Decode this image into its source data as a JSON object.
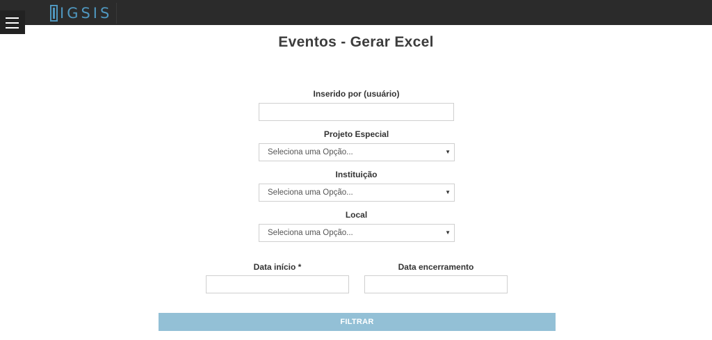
{
  "header": {
    "logo_text": "IGSIS",
    "menu_icon": "hamburger-icon",
    "colors": {
      "bar": "#2b2b2b",
      "logo": "#4f97bf"
    }
  },
  "page": {
    "title": "Eventos - Gerar Excel"
  },
  "form": {
    "inserido_por": {
      "label": "Inserido por (usuário)",
      "value": ""
    },
    "projeto_especial": {
      "label": "Projeto Especial",
      "selected": "Seleciona uma Opção..."
    },
    "instituicao": {
      "label": "Instituição",
      "selected": "Seleciona uma Opção..."
    },
    "local": {
      "label": "Local",
      "selected": "Seleciona uma Opção..."
    },
    "data_inicio": {
      "label": "Data início *",
      "value": ""
    },
    "data_encerramento": {
      "label": "Data encerramento",
      "value": ""
    },
    "submit_label": "FILTRAR",
    "submit_color": "#93c0d6",
    "dropdown_arrow": "▼"
  }
}
